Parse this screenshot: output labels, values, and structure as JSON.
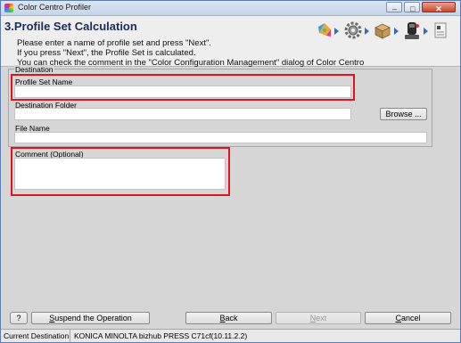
{
  "window": {
    "title": "Color Centro Profiler"
  },
  "header": {
    "step_title": "3.Profile Set Calculation",
    "instructions": [
      "Please enter a name of profile set and press \"Next\".",
      "If you press \"Next\", the Profile Set is calculated.",
      "You can check the comment in the \"Color Configuration Management\" dialog of Color Centro"
    ],
    "workflow_icons": [
      "color-wheel-icon",
      "settings-gear-icon",
      "box-profile-icon",
      "measuring-device-icon",
      "document-icon"
    ]
  },
  "destination": {
    "legend": "Destination",
    "profile_set_name": {
      "label": "Profile Set Name",
      "value": ""
    },
    "destination_folder": {
      "label": "Destination Folder",
      "value": "",
      "browse_label": "Browse ..."
    },
    "file_name": {
      "label": "File Name",
      "value": ""
    }
  },
  "comment": {
    "label": "Comment (Optional)",
    "value": ""
  },
  "footer": {
    "help_label": "?",
    "suspend_label": "Suspend the Operation",
    "back_label": "Back",
    "next_label": "Next",
    "cancel_label": "Cancel"
  },
  "status": {
    "label": "Current Destination",
    "value": "KONICA MINOLTA bizhub PRESS C71cf(10.11.2.2)"
  }
}
